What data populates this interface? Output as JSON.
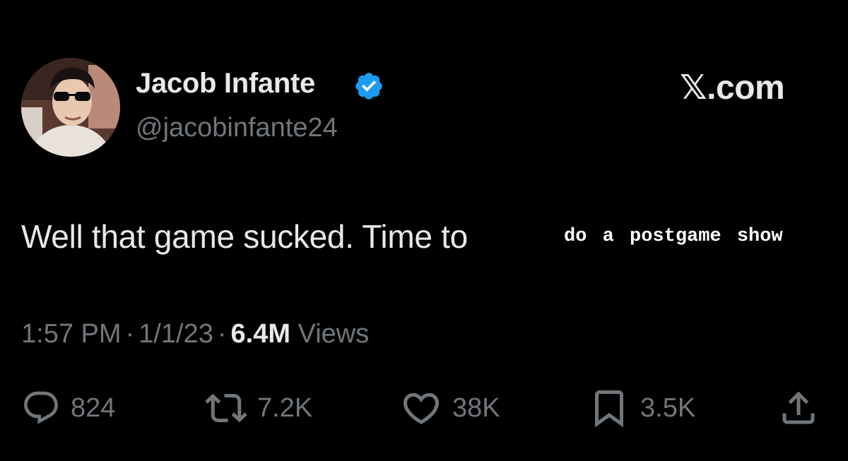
{
  "author": {
    "display_name": "Jacob Infante",
    "handle": "@jacobinfante24",
    "verified": true,
    "avatar_icon": "profile-photo"
  },
  "brand": "𝕏.com",
  "tweet": {
    "text": "Well that game sucked. Time to",
    "overlay_text": "do a postgame show"
  },
  "meta": {
    "time": "1:57 PM",
    "separator": "·",
    "date": "1/1/23",
    "views_count": "6.4M",
    "views_label": "Views"
  },
  "actions": {
    "replies": "824",
    "reposts": "7.2K",
    "likes": "38K",
    "bookmarks": "3.5K"
  },
  "colors": {
    "background": "#000000",
    "primary_text": "#e7e9ea",
    "secondary_text": "#71767b",
    "verified_blue": "#1d9bf0"
  }
}
